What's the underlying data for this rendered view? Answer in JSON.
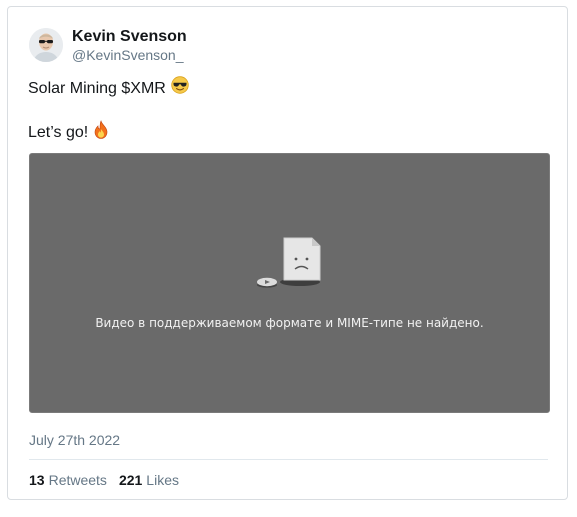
{
  "tweet": {
    "author": {
      "display_name": "Kevin Svenson",
      "handle": "@KevinSvenson_"
    },
    "text_line1": "Solar Mining $XMR",
    "text_line1_emoji": "smiling-face-with-sunglasses",
    "text_line2": "Let’s go!",
    "text_line2_emoji": "fire",
    "video": {
      "error_message": "Видео в поддерживаемом формате и MIME-типе не найдено."
    },
    "date": "July 27th 2022",
    "stats": {
      "retweets_count": "13",
      "retweets_label": "Retweets",
      "likes_count": "221",
      "likes_label": "Likes"
    }
  },
  "colors": {
    "text_primary": "#14171a",
    "text_secondary": "#657786",
    "video_bg": "#6a6a6a",
    "border": "#d9dde1"
  }
}
